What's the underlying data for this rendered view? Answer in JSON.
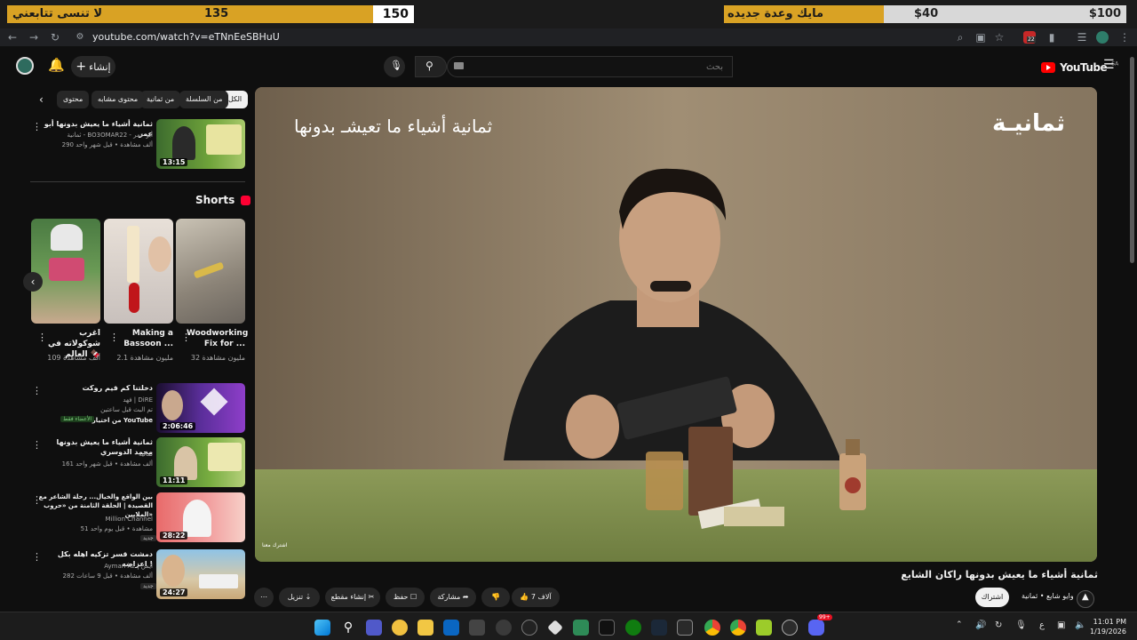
{
  "overlay": {
    "goal_text": "لا تنسى تتابعني",
    "goal_current": "135",
    "goal_target": "150",
    "mic_text": "مايك وعدة جديده",
    "dollar_low": "$40",
    "dollar_high": "$100"
  },
  "browser": {
    "url": "youtube.com/watch?v=eTNnEeSBHuU",
    "ext_badge": "22"
  },
  "header": {
    "create_label": "إنشاء",
    "search_placeholder": "بحث",
    "logo_text": "YouTube",
    "logo_region": "SA"
  },
  "chips": [
    "الكل",
    "من السلسلة",
    "من ثمانية",
    "محتوى مشابه",
    "محتوى"
  ],
  "sidebar_top_video": {
    "title": "ثمانية أشياء ما يعيش بدونها أبو عمر",
    "channel": "ثمانية - BO3OMAR22 - أبو عمر",
    "meta": "290 ألف مشاهدة • قبل شهر واحد",
    "duration": "13:15"
  },
  "shorts": {
    "heading": "Shorts",
    "items": [
      {
        "title": "Woodworking Fix for ...",
        "views": "32 مليون مشاهدة"
      },
      {
        "title": "Making a Bassoon ...",
        "views": "2.1 مليون مشاهدة"
      },
      {
        "title": "اغرب شوكولاته في العالم 🍫",
        "views": "109 ألف مشاهدة"
      }
    ]
  },
  "sidebar_videos": [
    {
      "title": "دخلتنا كم قيم روكت",
      "channel": "فهد | DiRE",
      "meta": "تم البث قبل ساعتين",
      "extra": "من اختيار YouTube",
      "badge": "الأعضاء فقط",
      "duration": "2:06:46"
    },
    {
      "title": "ثمانية أشياء ما يعيش بدونها محمد الدوسري",
      "channel": "ثمانية",
      "meta": "161 ألف مشاهدة • قبل شهر واحد",
      "extra": "",
      "badge": "",
      "duration": "11:11"
    },
    {
      "title": "بين الواقع والخيال... رحلة الشاعر مع القصيدة | الحلقة الثامنة من «حروب الملايين»",
      "channel": "Million Channel",
      "meta": "51 مشاهدة • قبل يوم واحد",
      "extra": "",
      "badge": "جديد",
      "duration": "28:22"
    },
    {
      "title": "دمشت قسر تزكيه اهله بكل اعراضه !",
      "channel": "Ayman Az | أيمن",
      "meta": "282 ألف مشاهدة • قبل 9 ساعات",
      "extra": "",
      "badge": "جديد",
      "duration": "24:27"
    }
  ],
  "player": {
    "overlay_logo": "ثمانيـة",
    "overlay_title": "ثمانية أشياء ما تعيشـ بدونها",
    "corner_text": "اشترك معنا"
  },
  "video": {
    "title": "ثمانية أشياء ما يعيش بدونها راكان الشايع",
    "channel": "ثمانية",
    "channel_sub": "وايو شايع",
    "subscribe": "اشتراك",
    "likes": "7 آلاف",
    "share": "مشاركة",
    "save": "حفظ",
    "clip": "إنشاء مقطع",
    "download": "تنزيل"
  },
  "taskbar": {
    "time": "11:01 PM",
    "date": "1/19/2026",
    "lang": "ع",
    "discord_badge": "99+"
  }
}
